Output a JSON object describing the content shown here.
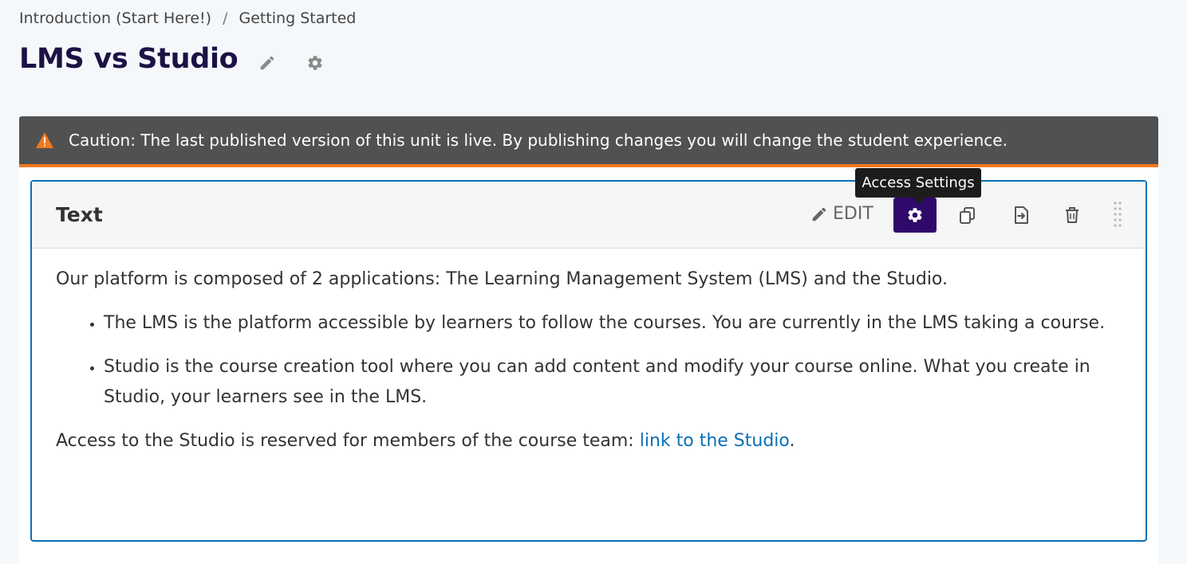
{
  "breadcrumb": {
    "parent": "Introduction (Start Here!)",
    "separator": "/",
    "current": "Getting Started"
  },
  "page": {
    "title": "LMS vs Studio"
  },
  "caution": {
    "text": "Caution: The last published version of this unit is live. By publishing changes you will change the student experience."
  },
  "block": {
    "title": "Text",
    "edit_label": "EDIT",
    "tooltip": "Access Settings",
    "intro": "Our platform is composed of 2 applications: The Learning Management System (LMS) and the Studio.",
    "bullets": [
      "The LMS is the platform accessible by learners to follow the courses. You are currently in the LMS taking a course.",
      "Studio is the course creation tool where you can add content and modify your course online. What you create in Studio, your learners see in the LMS."
    ],
    "access_text": "Access to the Studio is reserved for members of the course team: ",
    "link_text": "link to the Studio",
    "access_end": "."
  },
  "icons": {
    "title_edit": "pencil-icon",
    "title_settings": "gear-icon",
    "caution": "warning-icon",
    "access_settings": "gear-icon",
    "duplicate": "duplicate-icon",
    "move": "move-icon",
    "delete": "trash-icon",
    "drag": "drag-handle-icon"
  },
  "colors": {
    "title": "#1c1244",
    "accent": "#2f0a6a",
    "link": "#0a6fb5",
    "caution_border": "#f0781e",
    "warning_icon": "#f0781e"
  }
}
